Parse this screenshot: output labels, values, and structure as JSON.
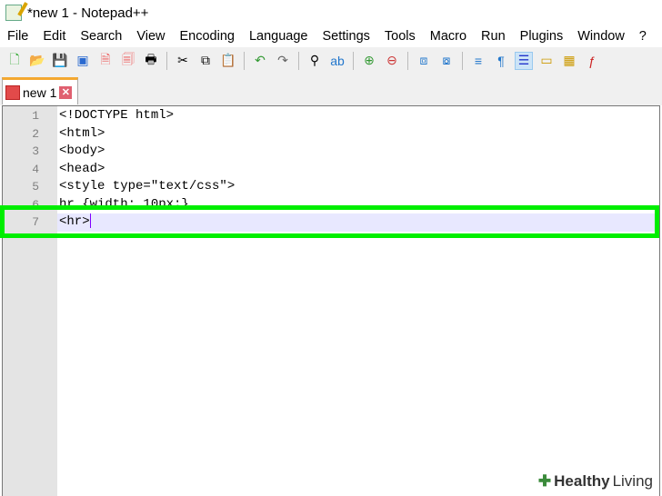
{
  "window": {
    "title": "*new 1 - Notepad++"
  },
  "menu": [
    "File",
    "Edit",
    "Search",
    "View",
    "Encoding",
    "Language",
    "Settings",
    "Tools",
    "Macro",
    "Run",
    "Plugins",
    "Window",
    "?"
  ],
  "toolbar": [
    "new-file",
    "open",
    "save",
    "save-all",
    "close",
    "close-all",
    "print",
    "cut",
    "copy",
    "paste",
    "undo",
    "redo",
    "find",
    "replace",
    "zoom-in",
    "zoom-out",
    "sync-v",
    "sync-h",
    "word-wrap",
    "show-all-chars",
    "indent-guide",
    "udl",
    "doc-map",
    "function-list"
  ],
  "tab": {
    "label": "new 1",
    "close": "✕"
  },
  "editor": {
    "lines": [
      {
        "n": "1",
        "text": "<!DOCTYPE html>"
      },
      {
        "n": "2",
        "text": "<html>"
      },
      {
        "n": "3",
        "text": "<body>"
      },
      {
        "n": "4",
        "text": "<head>"
      },
      {
        "n": "5",
        "text": "<style type=\"text/css\">"
      },
      {
        "n": "6",
        "text": "hr {width: 10px;}"
      },
      {
        "n": "7",
        "text": "<hr>"
      }
    ]
  },
  "watermark": {
    "bold": "Healthy",
    "light": "Living"
  },
  "colors": {
    "highlight": "#00ee00",
    "current_line": "#e8e8ff"
  }
}
